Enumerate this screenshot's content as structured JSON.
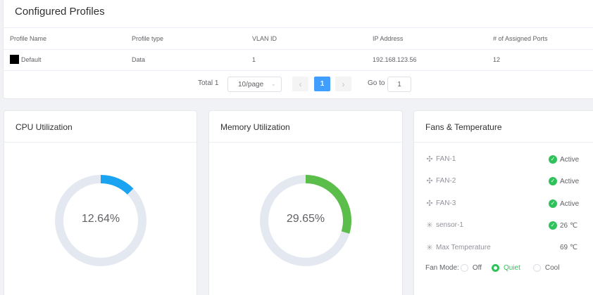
{
  "profiles": {
    "title": "Configured Profiles",
    "columns": [
      "Profile Name",
      "Profile type",
      "VLAN ID",
      "IP Address",
      "# of Assigned Ports"
    ],
    "rows": [
      {
        "name": "Default",
        "type": "Data",
        "vlan": "1",
        "ip": "192.168.123.56",
        "ports": "12",
        "color": "#000000"
      }
    ],
    "pagination": {
      "total": "Total 1",
      "page_size": "10/page",
      "current_page": "1",
      "goto_label": "Go to",
      "goto_value": "1"
    }
  },
  "cpu": {
    "title": "CPU Utilization",
    "value_label": "12.64%",
    "value": 12.64,
    "color": "#1aa3f0"
  },
  "memory": {
    "title": "Memory Utilization",
    "value_label": "29.65%",
    "value": 29.65,
    "color": "#5cbe4a"
  },
  "fans": {
    "title": "Fans & Temperature",
    "items": [
      {
        "name": "FAN-1",
        "icon": "fan-icon",
        "status": "Active"
      },
      {
        "name": "FAN-2",
        "icon": "fan-icon",
        "status": "Active"
      },
      {
        "name": "FAN-3",
        "icon": "fan-icon",
        "status": "Active"
      },
      {
        "name": "sensor-1",
        "icon": "sensor-icon",
        "status": "26 ℃"
      },
      {
        "name": "Max Temperature",
        "icon": "sensor-icon",
        "status": "69 ℃"
      }
    ],
    "mode_label": "Fan Mode:",
    "modes": [
      "Off",
      "Quiet",
      "Cool"
    ],
    "selected_mode": "Quiet"
  },
  "colors": {
    "accent": "#409eff",
    "ok": "#2fc25b",
    "track": "#e4e8f0"
  }
}
